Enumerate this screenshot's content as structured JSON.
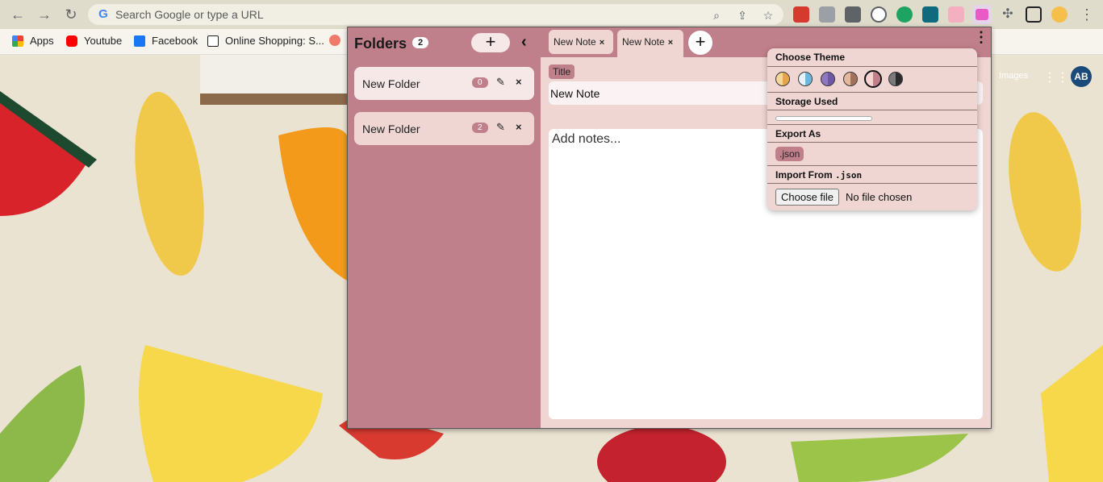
{
  "browser": {
    "url_placeholder": "Search Google or type a URL",
    "bookmarks": [
      {
        "label": "Apps",
        "icon": "apps-grid-icon"
      },
      {
        "label": "Youtube",
        "icon": "youtube-icon"
      },
      {
        "label": "Facebook",
        "icon": "facebook-icon"
      },
      {
        "label": "Online Shopping: S...",
        "icon": "amazon-icon"
      }
    ],
    "google": {
      "images_link": "Images",
      "avatar_initials": "AB"
    }
  },
  "sidebar": {
    "title": "Folders",
    "folder_count": "2",
    "add_label": "+",
    "collapse_label": "‹",
    "folders": [
      {
        "name": "New Folder",
        "count": "0",
        "edit": "✎",
        "delete": "×"
      },
      {
        "name": "New Folder",
        "count": "2",
        "edit": "✎",
        "delete": "×"
      }
    ]
  },
  "tabs": [
    {
      "label": "New Note",
      "close": "×"
    },
    {
      "label": "New Note",
      "close": "×"
    }
  ],
  "add_tab_label": "+",
  "menu_label": "⋮",
  "editor": {
    "title_label": "Title",
    "title_value": "New Note",
    "notes_placeholder": "Add notes..."
  },
  "settings": {
    "theme_heading": "Choose Theme",
    "themes": [
      {
        "name": "orange",
        "left": "#f6d79a",
        "right": "#e8a24c"
      },
      {
        "name": "blue",
        "left": "#e4f2fb",
        "right": "#6cb6e0"
      },
      {
        "name": "purple",
        "left": "#8f78bf",
        "right": "#6e58a5"
      },
      {
        "name": "brown",
        "left": "#e2b99c",
        "right": "#a3715a"
      },
      {
        "name": "pink",
        "left": "#f4d3d1",
        "right": "#c0808b"
      },
      {
        "name": "dark",
        "left": "#7a7a7a",
        "right": "#2b2b2b"
      }
    ],
    "selected_theme": "pink",
    "storage_heading": "Storage Used",
    "storage_fraction": 0.0,
    "export_heading": "Export As",
    "export_button": ".json",
    "import_heading": "Import From",
    "import_format": ".json",
    "choose_file_label": "Choose file",
    "no_file_text": "No file chosen"
  },
  "colors": {
    "accent": "#c0808b",
    "panel": "#efd6d3",
    "active_folder": "#f7e8e8"
  }
}
